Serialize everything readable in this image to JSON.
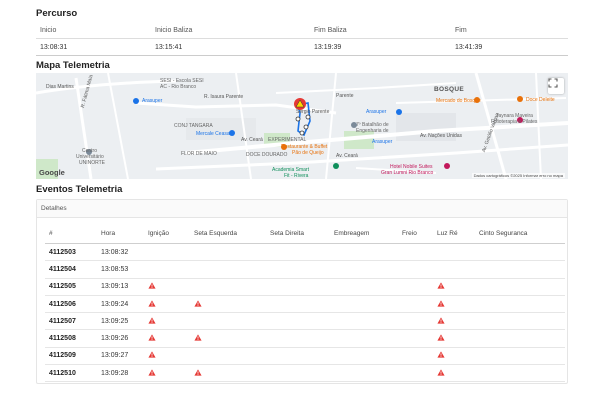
{
  "percurso": {
    "title": "Percurso",
    "headers": [
      "Inicio",
      "Inicio Baliza",
      "Fim Baliza",
      "Fim"
    ],
    "values": [
      "13:08:31",
      "13:15:41",
      "13:19:39",
      "13:41:39"
    ]
  },
  "mapa": {
    "title": "Mapa Telemetria",
    "labels": {
      "sesi": "SESI - Escola SESI",
      "sesi2": "AC - Rio Branco",
      "diasmartins": "Dias Martins",
      "fatimamaia": "R. Fátima Maia",
      "isauraparente": "R. Isaura Parente",
      "arasuper1": "Arasuper",
      "arasuper2": "Arasuper",
      "arasuper3": "Arasuper",
      "conjtangara": "CONJ TANGARA",
      "mercale": "Mercale Ceasa",
      "florde": "FLOR DE MAIO",
      "docedourado": "DOCE DOURADO",
      "experimental": "EXPERIMENTAL",
      "restaurante": "Restaurante & Buffet",
      "restaurante2": "Pão de Queijo",
      "batalhao": "7º Batalhão de",
      "batalhao2": "Engenharia de",
      "centro": "Centro",
      "centro2": "Universitário",
      "centro3": "UNINORTE",
      "bosque": "BOSQUE",
      "mercado": "Mercado do Bosque",
      "docedeleite": "Doce Deleite",
      "taynara": "Taynara Maveira",
      "taynara2": "Fisioterapia e Pilates",
      "hotel": "Hotel Nobile Suites",
      "hotel2": "Gran Lumni Rio Branco",
      "academia": "Academia Smart",
      "academia2": "Fit - Rivera",
      "avceara": "Av. Ceará",
      "avnacoes": "Av. Nações Unidas",
      "sergioparente": "Sergio Parente",
      "fatimaparente": "Parente",
      "avceara2": "Av. Ceará",
      "avbrasil": "Av. Getúlio Vargas"
    },
    "google": "Google",
    "attribution": "Dados cartográficos ©2025  Informar erro no mapa",
    "fullscreen_icon": "fullscreen-icon"
  },
  "eventos": {
    "title": "Eventos Telemetria",
    "subtitle": "Detalhes",
    "headers": [
      "#",
      "Hora",
      "Ignição",
      "Seta Esquerda",
      "Seta Direita",
      "Embreagem",
      "Freio",
      "Luz Ré",
      "Cinto Seguranca"
    ],
    "warn_color": "#e53935",
    "rows": [
      {
        "id": "4112503",
        "hora": "13:08:32",
        "flags": [
          false,
          false,
          false,
          false,
          false,
          false,
          false
        ]
      },
      {
        "id": "4112504",
        "hora": "13:08:53",
        "flags": [
          false,
          false,
          false,
          false,
          false,
          false,
          false
        ]
      },
      {
        "id": "4112505",
        "hora": "13:09:13",
        "flags": [
          true,
          false,
          false,
          false,
          false,
          true,
          false
        ]
      },
      {
        "id": "4112506",
        "hora": "13:09:24",
        "flags": [
          true,
          true,
          false,
          false,
          false,
          true,
          false
        ]
      },
      {
        "id": "4112507",
        "hora": "13:09:25",
        "flags": [
          true,
          false,
          false,
          false,
          false,
          true,
          false
        ]
      },
      {
        "id": "4112508",
        "hora": "13:09:26",
        "flags": [
          true,
          true,
          false,
          false,
          false,
          true,
          false
        ]
      },
      {
        "id": "4112509",
        "hora": "13:09:27",
        "flags": [
          true,
          false,
          false,
          false,
          false,
          true,
          false
        ]
      },
      {
        "id": "4112510",
        "hora": "13:09:28",
        "flags": [
          true,
          true,
          false,
          false,
          false,
          true,
          false
        ]
      }
    ]
  }
}
